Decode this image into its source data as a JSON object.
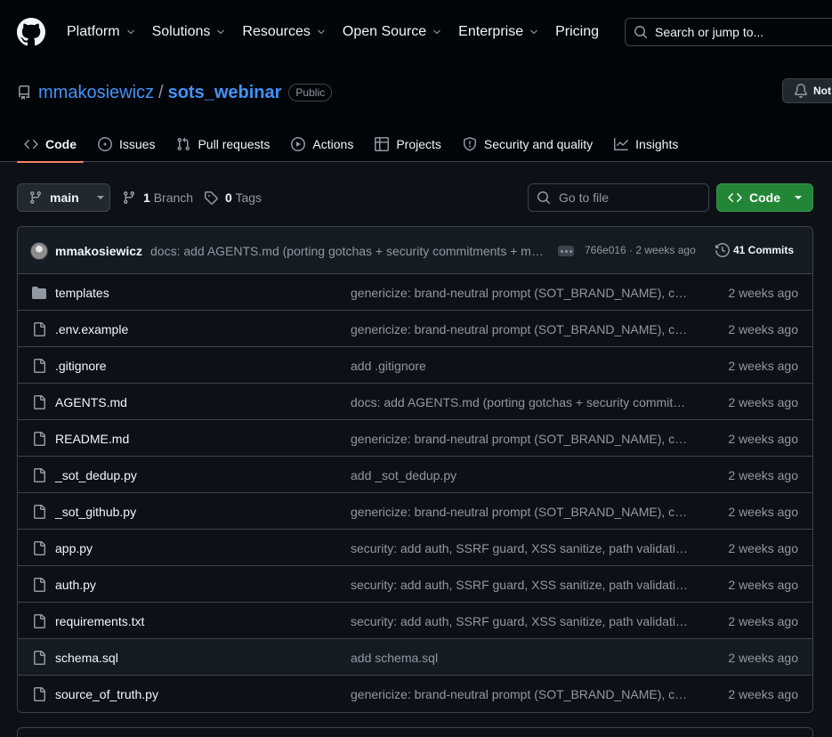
{
  "nav": {
    "items": [
      {
        "label": "Platform",
        "dropdown": true
      },
      {
        "label": "Solutions",
        "dropdown": true
      },
      {
        "label": "Resources",
        "dropdown": true
      },
      {
        "label": "Open Source",
        "dropdown": true
      },
      {
        "label": "Enterprise",
        "dropdown": true
      },
      {
        "label": "Pricing",
        "dropdown": false
      }
    ],
    "search_placeholder": "Search or jump to..."
  },
  "repo": {
    "owner": "mmakosiewicz",
    "separator": "/",
    "name": "sots_webinar",
    "visibility": "Public",
    "notify_label": "Not"
  },
  "tabs": [
    {
      "label": "Code",
      "icon": "code-icon",
      "active": true
    },
    {
      "label": "Issues",
      "icon": "issue-opened-icon",
      "active": false
    },
    {
      "label": "Pull requests",
      "icon": "git-pull-request-icon",
      "active": false
    },
    {
      "label": "Actions",
      "icon": "play-icon",
      "active": false
    },
    {
      "label": "Projects",
      "icon": "table-icon",
      "active": false
    },
    {
      "label": "Security and quality",
      "icon": "shield-icon",
      "active": false
    },
    {
      "label": "Insights",
      "icon": "graph-icon",
      "active": false
    }
  ],
  "toolbar": {
    "branch": "main",
    "branch_count": "1",
    "branch_word": "Branch",
    "tag_count": "0",
    "tag_word": "Tags",
    "goto_file": "Go to file",
    "code_button": "Code"
  },
  "latest_commit": {
    "author": "mmakosiewicz",
    "message": "docs: add AGENTS.md (porting gotchas + security commitments + mirror-sync notes)",
    "sha_time": "766e016 · 2 weeks ago",
    "commits_label": "41 Commits"
  },
  "files": [
    {
      "name": "templates",
      "type": "dir",
      "message": "genericize: brand-neutral prompt (SOT_BRAND_NAME), configurable paths",
      "age": "2 weeks ago"
    },
    {
      "name": ".env.example",
      "type": "file",
      "message": "genericize: brand-neutral prompt (SOT_BRAND_NAME), configurable paths",
      "age": "2 weeks ago"
    },
    {
      "name": ".gitignore",
      "type": "file",
      "message": "add .gitignore",
      "age": "2 weeks ago"
    },
    {
      "name": "AGENTS.md",
      "type": "file",
      "message": "docs: add AGENTS.md (porting gotchas + security commitments)",
      "age": "2 weeks ago"
    },
    {
      "name": "README.md",
      "type": "file",
      "message": "genericize: brand-neutral prompt (SOT_BRAND_NAME), configurable paths",
      "age": "2 weeks ago"
    },
    {
      "name": "_sot_dedup.py",
      "type": "file",
      "message": "add _sot_dedup.py",
      "age": "2 weeks ago"
    },
    {
      "name": "_sot_github.py",
      "type": "file",
      "message": "genericize: brand-neutral prompt (SOT_BRAND_NAME), configurable paths",
      "age": "2 weeks ago"
    },
    {
      "name": "app.py",
      "type": "file",
      "message": "security: add auth, SSRF guard, XSS sanitize, path validation",
      "age": "2 weeks ago"
    },
    {
      "name": "auth.py",
      "type": "file",
      "message": "security: add auth, SSRF guard, XSS sanitize, path validation",
      "age": "2 weeks ago"
    },
    {
      "name": "requirements.txt",
      "type": "file",
      "message": "security: add auth, SSRF guard, XSS sanitize, path validation",
      "age": "2 weeks ago"
    },
    {
      "name": "schema.sql",
      "type": "file",
      "message": "add schema.sql",
      "age": "2 weeks ago",
      "hover": true
    },
    {
      "name": "source_of_truth.py",
      "type": "file",
      "message": "genericize: brand-neutral prompt (SOT_BRAND_NAME), configurable paths",
      "age": "2 weeks ago"
    }
  ],
  "colors": {
    "background": "#0d1117",
    "header": "#010409",
    "accent_link": "#4493f8",
    "active_tab_underline": "#f78166",
    "code_button": "#238636"
  }
}
